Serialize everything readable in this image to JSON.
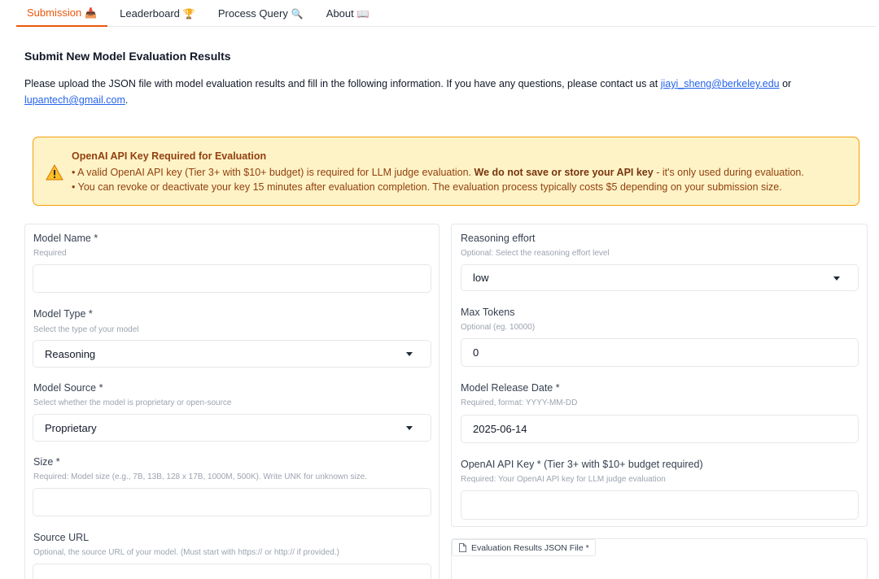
{
  "tabs": [
    {
      "label": "Submission",
      "emoji": "📥"
    },
    {
      "label": "Leaderboard",
      "emoji": "🏆"
    },
    {
      "label": "Process Query",
      "emoji": "🔍"
    },
    {
      "label": "About",
      "emoji": "📖"
    }
  ],
  "page": {
    "heading": "Submit New Model Evaluation Results",
    "intro_text": "Please upload the JSON file with model evaluation results and fill in the following information. If you have any questions, please contact us at",
    "email_1": "jiayi_sheng@berkeley.edu",
    "or_text": "or",
    "email_2": "lupantech@gmail.com",
    "period": "."
  },
  "warning": {
    "title": "OpenAI API Key Required for Evaluation",
    "line1_prefix": "• A valid OpenAI API key (Tier 3+ with $10+ budget) is required for LLM judge evaluation.",
    "line1_bold": "We do not save or store your API key",
    "line1_suffix": "- it's only used during evaluation.",
    "line2": "• You can revoke or deactivate your key 15 minutes after evaluation completion. The evaluation process typically costs $5 depending on your submission size.",
    "color_bg": "#fef3c7",
    "color_border": "#f59e0b"
  },
  "left_form": {
    "model_name": {
      "label": "Model Name *",
      "help": "Required",
      "value": ""
    },
    "model_type": {
      "label": "Model Type *",
      "help": "Select the type of your model",
      "value": "Reasoning"
    },
    "model_source": {
      "label": "Model Source *",
      "help": "Select whether the model is proprietary or open-source",
      "value": "Proprietary"
    },
    "size": {
      "label": "Size *",
      "help": "Required: Model size (e.g., 7B, 13B, 128 x 17B, 1000M, 500K). Write UNK for unknown size.",
      "value": ""
    },
    "source_url": {
      "label": "Source URL",
      "help": "Optional, the source URL of your model. (Must start with https:// or http:// if provided.)",
      "value": ""
    }
  },
  "right_form": {
    "reasoning_effort": {
      "label": "Reasoning effort",
      "help": "Optional: Select the reasoning effort level",
      "value": "low"
    },
    "max_tokens": {
      "label": "Max Tokens",
      "help": "Optional (eg. 10000)",
      "value": "0"
    },
    "release_date": {
      "label": "Model Release Date *",
      "help": "Required, format: YYYY-MM-DD",
      "value": "2025-06-14"
    },
    "api_key": {
      "label": "OpenAI API Key * (Tier 3+ with $10+ budget required)",
      "help": "Required: Your OpenAI API key for LLM judge evaluation",
      "value": ""
    }
  },
  "upload": {
    "label": "Evaluation Results JSON File *",
    "icon": "file-icon"
  },
  "colors": {
    "accent": "#ea580c",
    "link": "#2563eb"
  }
}
